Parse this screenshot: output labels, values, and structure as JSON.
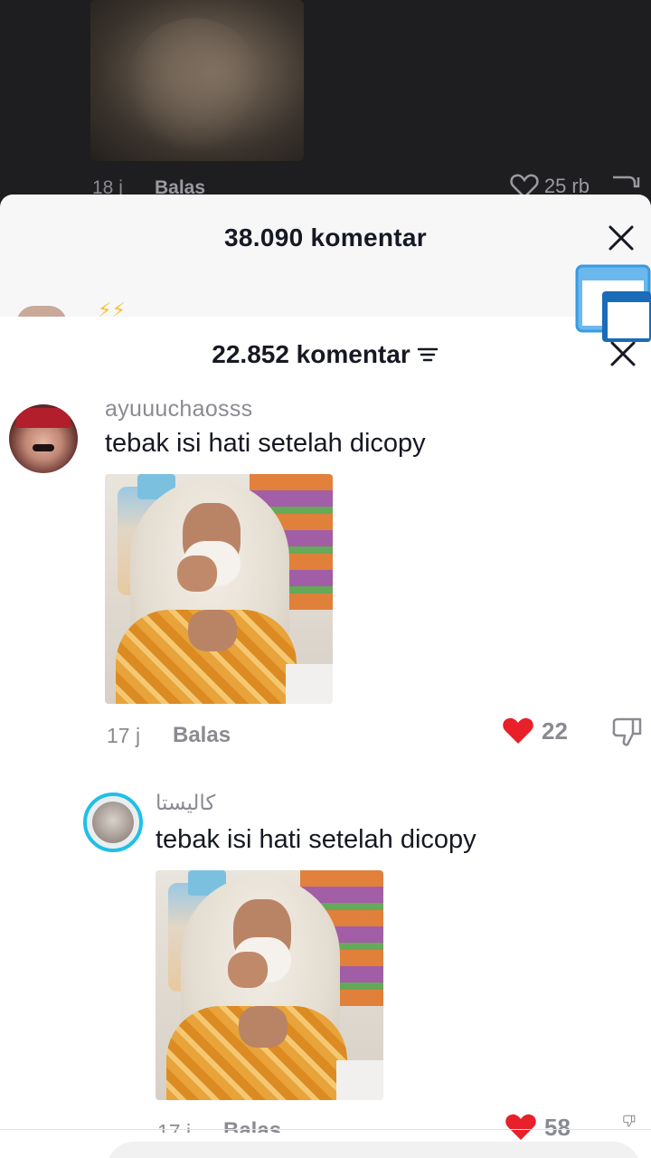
{
  "background_video": {
    "comment_time": "18 j",
    "reply_label": "Balas",
    "like_count": "25 rb"
  },
  "back_sheet": {
    "title": "38.090 komentar"
  },
  "sheet": {
    "title": "22.852 komentar"
  },
  "comments": [
    {
      "username": "ayuuuchaosss",
      "text": "tebak isi hati setelah dicopy",
      "time": "17 j",
      "reply_label": "Balas",
      "likes": "22",
      "liked": true
    },
    {
      "username": "كاليستا",
      "text": "tebak isi hati setelah dicopy",
      "time": "17 j",
      "reply_label": "Balas",
      "likes": "58",
      "liked": true
    }
  ],
  "icons": {
    "heart_filled_color": "#e8202a",
    "accent_blue": "#1c9bf0"
  }
}
